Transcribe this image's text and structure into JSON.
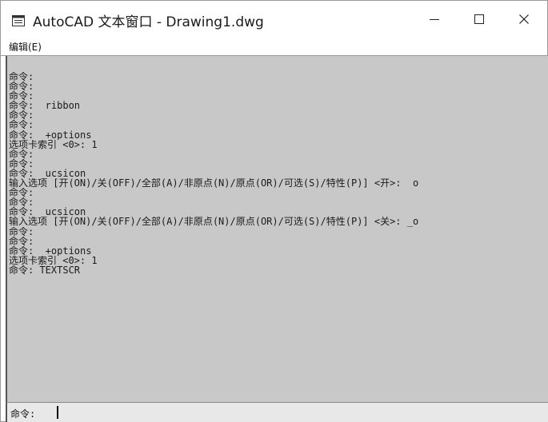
{
  "window": {
    "title": "AutoCAD 文本窗口 - Drawing1.dwg",
    "controls": {
      "minimize": "—",
      "maximize": "☐",
      "close": "✕"
    },
    "icon": "window-app-icon"
  },
  "menu": {
    "edit": "编辑(E)"
  },
  "output_lines": [
    "命令:",
    "命令:",
    "命令:",
    "命令: _ribbon",
    "命令:",
    "命令:",
    "命令: _+options",
    "选项卡索引 <0>: 1",
    "命令:",
    "命令:",
    "命令: _ucsicon",
    "输入选项 [开(ON)/关(OFF)/全部(A)/非原点(N)/原点(OR)/可选(S)/特性(P)] <开>: _o",
    "命令:",
    "命令:",
    "命令: _ucsicon",
    "输入选项 [开(ON)/关(OFF)/全部(A)/非原点(N)/原点(OR)/可选(S)/特性(P)] <关>: _o",
    "命令:",
    "命令:",
    "命令: _+options",
    "选项卡索引 <0>: 1",
    "命令: TEXTSCR"
  ],
  "command_input": {
    "prompt": "命令:",
    "value": ""
  },
  "colors": {
    "output_bg": "#c8c8c8",
    "input_bg": "#e8e8e8"
  }
}
